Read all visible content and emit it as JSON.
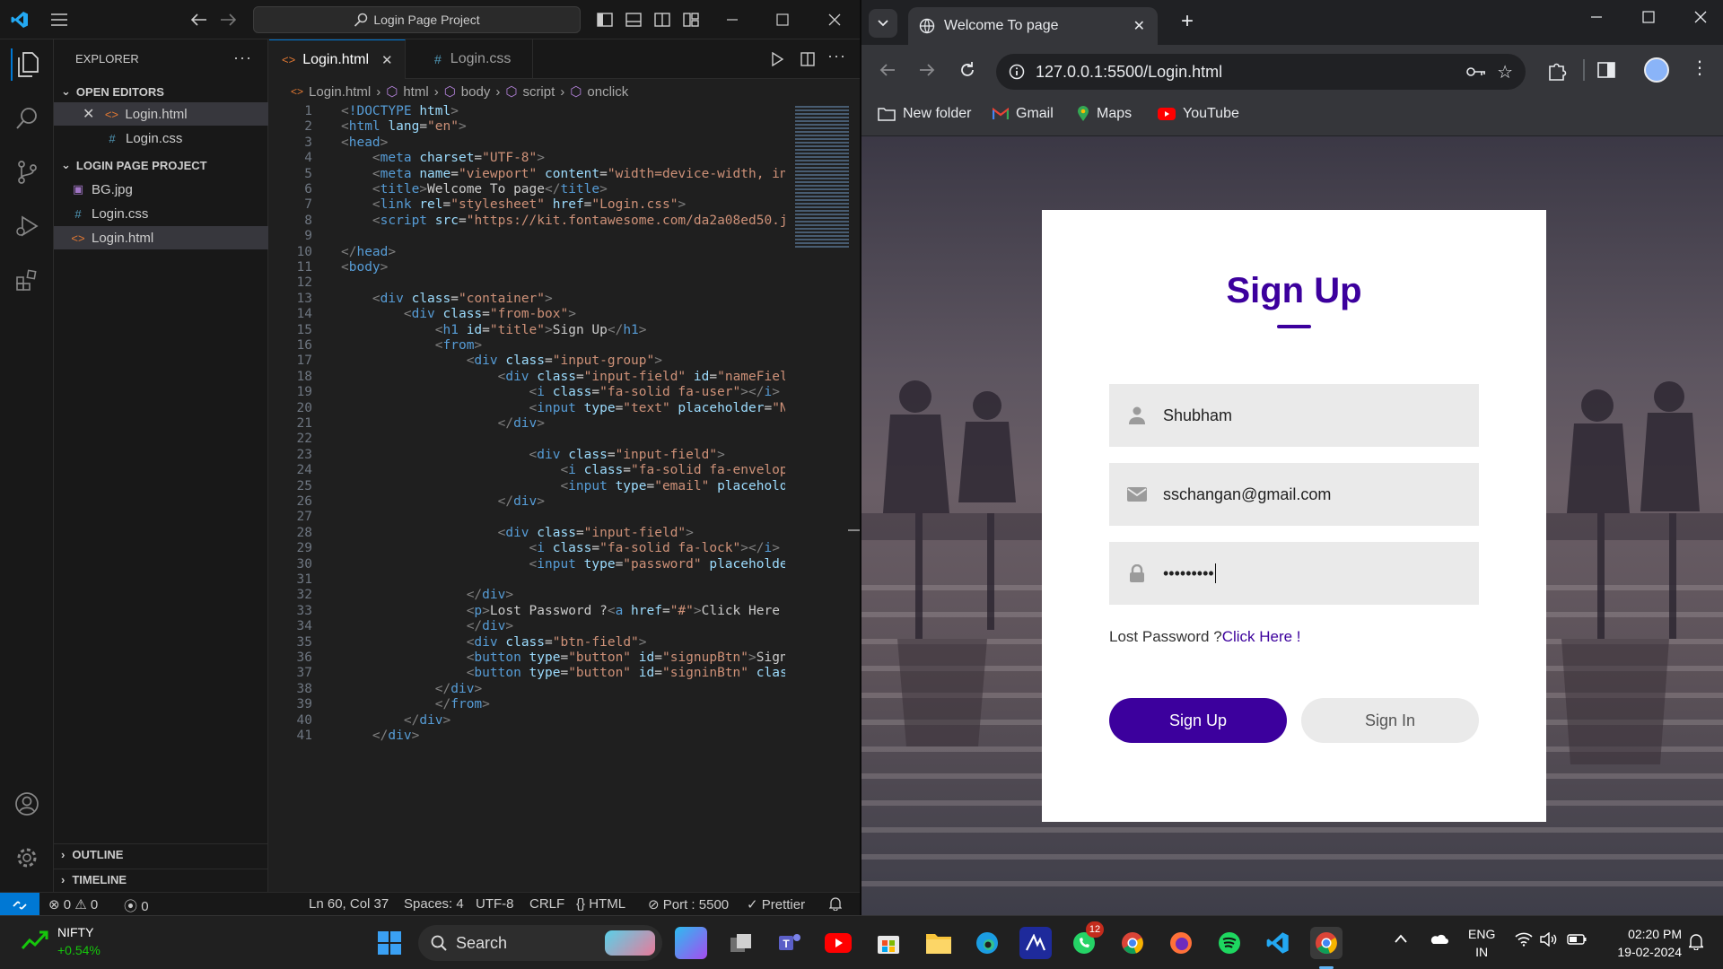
{
  "vscode": {
    "title_search": "Login Page Project",
    "sidebar": {
      "header": "EXPLORER",
      "open_editors_label": "OPEN EDITORS",
      "open_editors": [
        "Login.html",
        "Login.css"
      ],
      "project_label": "LOGIN PAGE PROJECT",
      "files": [
        "BG.jpg",
        "Login.css",
        "Login.html"
      ],
      "outline_label": "OUTLINE",
      "timeline_label": "TIMELINE"
    },
    "tabs": [
      "Login.html",
      "Login.css"
    ],
    "breadcrumb": [
      "Login.html",
      "html",
      "body",
      "script",
      "onclick"
    ],
    "code_lines": [
      "<!DOCTYPE html>",
      "<html lang=\"en\">",
      "<head>",
      "    <meta charset=\"UTF-8\">",
      "    <meta name=\"viewport\" content=\"width=device-width, in",
      "    <title>Welcome To page</title>",
      "    <link rel=\"stylesheet\" href=\"Login.css\">",
      "    <script src=\"https://kit.fontawesome.com/da2a08ed50.j",
      "",
      "</head>",
      "<body>",
      "",
      "    <div class=\"container\">",
      "        <div class=\"from-box\">",
      "            <h1 id=\"title\">Sign Up</h1>",
      "            <from>",
      "                <div class=\"input-group\">",
      "                    <div class=\"input-field\" id=\"nameFiel",
      "                        <i class=\"fa-solid fa-user\"></i>",
      "                        <input type=\"text\" placeholder=\"N",
      "                    </div>",
      "",
      "                        <div class=\"input-field\">",
      "                            <i class=\"fa-solid fa-envelop",
      "                            <input type=\"email\" placehold",
      "                    </div>",
      "",
      "                    <div class=\"input-field\">",
      "                        <i class=\"fa-solid fa-lock\"></i>",
      "                        <input type=\"password\" placeholde",
      "",
      "                </div>",
      "                <p>Lost Password ?<a href=\"#\">Click Here",
      "                </div>",
      "                <div class=\"btn-field\">",
      "                <button type=\"button\" id=\"signupBtn\">Sign",
      "                <button type=\"button\" id=\"signinBtn\" clas",
      "            </div>",
      "            </from>",
      "        </div>",
      "    </div>"
    ],
    "status": {
      "errors": "0",
      "warnings": "0",
      "ports": "0",
      "position": "Ln 60, Col 37",
      "spaces": "Spaces: 4",
      "encoding": "UTF-8",
      "eol": "CRLF",
      "language": "HTML",
      "port": "Port : 5500",
      "prettier": "Prettier"
    }
  },
  "browser": {
    "tab_title": "Welcome To page",
    "url": "127.0.0.1:5500/Login.html",
    "bookmarks": [
      "New folder",
      "Gmail",
      "Maps",
      "YouTube"
    ],
    "page": {
      "title": "Sign Up",
      "name_value": "Shubham",
      "email_value": "sschangan@gmail.com",
      "password_value": "•••••••••",
      "lost_password_text": "Lost Password ?",
      "lost_password_link": "Click Here !",
      "signup_button": "Sign Up",
      "signin_button": "Sign In"
    }
  },
  "taskbar": {
    "ticker_name": "NIFTY",
    "ticker_change": "+0.54%",
    "search_label": "Search",
    "whatsapp_badge": "12",
    "language": "ENG",
    "region": "IN",
    "time": "02:20 PM",
    "date": "19-02-2024"
  }
}
